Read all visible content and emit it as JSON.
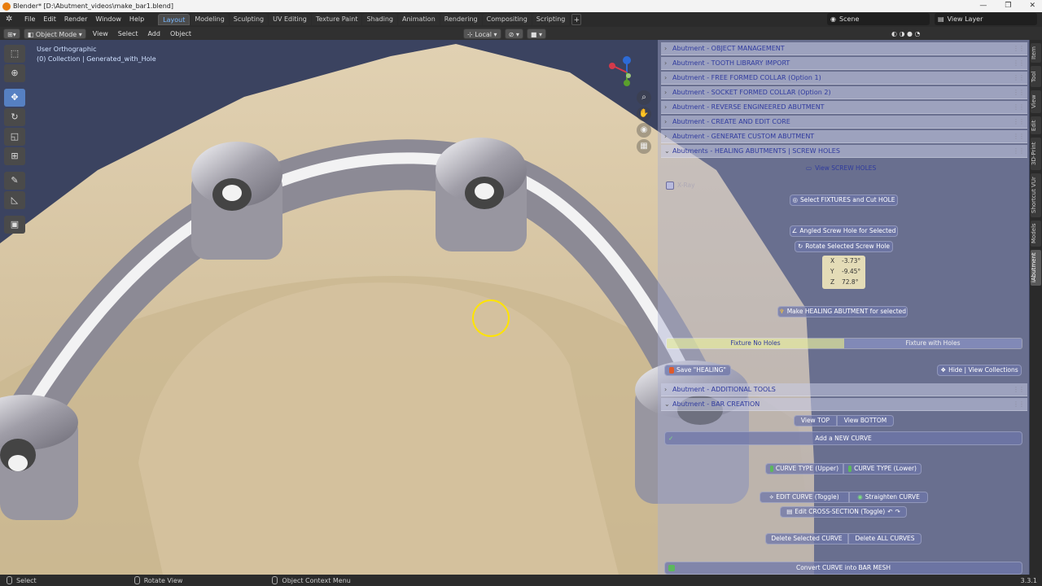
{
  "window": {
    "title": "Blender* [D:\\Abutment_videos\\make_bar1.blend]",
    "controls": [
      "—",
      "❐",
      "✕"
    ]
  },
  "menubar": {
    "menus": [
      "File",
      "Edit",
      "Render",
      "Window",
      "Help"
    ],
    "workspaces": [
      "Layout",
      "Modeling",
      "Sculpting",
      "UV Editing",
      "Texture Paint",
      "Shading",
      "Animation",
      "Rendering",
      "Compositing",
      "Scripting"
    ],
    "active_workspace": "Layout",
    "add_workspace": "+",
    "scene": "Scene",
    "view_layer": "View Layer"
  },
  "header": {
    "mode": "Object Mode",
    "menus": [
      "View",
      "Select",
      "Add",
      "Object"
    ],
    "orientation": "Local"
  },
  "viewport": {
    "view_name": "User Orthographic",
    "collection": "(0) Collection | Generated_with_Hole",
    "gizmo": {
      "x": "X",
      "y": "Y",
      "z": "Z"
    }
  },
  "toolbar": {
    "tools": [
      "select-box",
      "cursor",
      "move",
      "rotate",
      "scale",
      "transform",
      "annotate",
      "measure",
      "add-cube"
    ],
    "active_tool": "move"
  },
  "panels": {
    "headers": [
      "Abutment - OBJECT MANAGEMENT",
      "Abutment - TOOTH LIBRARY IMPORT",
      "Abutment - FREE FORMED COLLAR (Option 1)",
      "Abutment - SOCKET FORMED COLLAR (Option 2)",
      "Abutment - REVERSE ENGINEERED ABUTMENT",
      "Abutment - CREATE AND EDIT CORE",
      "Abutment - GENERATE CUSTOM ABUTMENT",
      "Abutments - HEALING ABUTMENTS | SCREW HOLES"
    ],
    "healing": {
      "view_screw_holes": "View SCREW HOLES",
      "xray_label": "X-Ray",
      "select_fixtures": "Select FIXTURES and Cut HOLE",
      "angled_screw": "Angled Screw Hole for Selected",
      "rotate_screw": "Rotate Selected Screw Hole",
      "rotation": {
        "x_label": "X",
        "x": "-3.73°",
        "y_label": "Y",
        "y": "-9.45°",
        "z_label": "Z",
        "z": "72.8°"
      },
      "make_healing": "Make HEALING ABUTMENT for selected",
      "fixture_no_holes": "Fixture No Holes",
      "fixture_with_holes": "Fixture with Holes",
      "save_healing": "Save \"HEALING\"",
      "hide_view_collections": "Hide | View Collections"
    },
    "additional_tools": "Abutment - ADDITIONAL TOOLS",
    "bar_creation": {
      "header": "Abutment - BAR CREATION",
      "view_top": "View TOP",
      "view_bottom": "View BOTTOM",
      "add_curve": "Add  a NEW CURVE",
      "curve_upper": "CURVE TYPE (Upper)",
      "curve_lower": "CURVE TYPE (Lower)",
      "edit_curve": "EDIT CURVE (Toggle)",
      "straighten_curve": "Straighten CURVE",
      "edit_cross_section": "Edit CROSS-SECTION (Toggle)",
      "delete_selected": "Delete Selected CURVE",
      "delete_all": "Delete ALL CURVES",
      "convert": "Convert CURVE into BAR MESH"
    }
  },
  "side_tabs": [
    "Item",
    "Tool",
    "View",
    "Edit",
    "3D-Print",
    "Shortcut VUr",
    "Models",
    "iAbutment"
  ],
  "active_side_tab": "iAbutment",
  "status": {
    "select": "Select",
    "rotate_view": "Rotate View",
    "context_menu": "Object Context Menu",
    "version": "3.3.1"
  },
  "colors": {
    "accent_blue": "#2f3a9e",
    "gum": "#d8c5a3",
    "bar_metal": "#8f8d99",
    "cursor_ring": "#ffe400"
  }
}
